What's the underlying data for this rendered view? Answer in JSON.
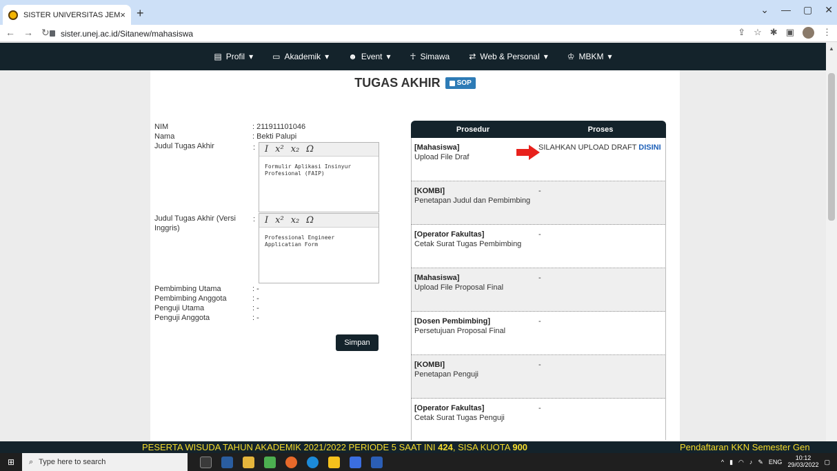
{
  "browser": {
    "tab_title": "SISTER UNIVERSITAS JEMBER",
    "tab_close": "×",
    "new_tab": "+",
    "url": "sister.unej.ac.id/Sitanew/mahasiswa"
  },
  "nav": {
    "items": [
      {
        "label": "Profil",
        "caret": "▾",
        "icon": "id-card-icon"
      },
      {
        "label": "Akademik",
        "caret": "▾",
        "icon": "monitor-icon"
      },
      {
        "label": "Event",
        "caret": "▾",
        "icon": "people-icon"
      },
      {
        "label": "Simawa",
        "caret": "",
        "icon": "run-icon"
      },
      {
        "label": "Web & Personal",
        "caret": "▾",
        "icon": "shuffle-icon"
      },
      {
        "label": "MBKM",
        "caret": "▾",
        "icon": "graduation-icon"
      }
    ]
  },
  "page": {
    "title": "TUGAS AKHIR",
    "sop_label": "SOP"
  },
  "form": {
    "nim_label": "NIM",
    "nim_value": ": 211911101046",
    "nama_label": "Nama",
    "nama_value": ": Bekti Palupi",
    "judul_label": "Judul Tugas Akhir",
    "judul_colon": ":",
    "judul_text": "Formulir Aplikasi Insinyur Profesional (FAIP)",
    "judul_en_label": "Judul Tugas Akhir (Versi Inggris)",
    "judul_en_colon": ":",
    "judul_en_text": "Professional Engineer Applicatian Form",
    "pembimbing_utama_label": "Pembimbing Utama",
    "pembimbing_utama_value": ": -",
    "pembimbing_anggota_label": "Pembimbing Anggota",
    "pembimbing_anggota_value": ": -",
    "penguji_utama_label": "Penguji Utama",
    "penguji_utama_value": ": -",
    "penguji_anggota_label": "Penguji Anggota",
    "penguji_anggota_value": ": -",
    "toolbar": {
      "italic": "I",
      "superscript": "x²",
      "subscript": "x₂",
      "omega": "Ω"
    },
    "save_label": "Simpan"
  },
  "table": {
    "header_prosedur": "Prosedur",
    "header_proses": "Proses",
    "rows": [
      {
        "role": "[Mahasiswa]",
        "desc": "Upload File Draf",
        "proses_prefix": "SILAHKAN UPLOAD DRAFT ",
        "proses_link": "DISINI"
      },
      {
        "role": "[KOMBI]",
        "desc": "Penetapan Judul dan Pembimbing",
        "proses": "-"
      },
      {
        "role": "[Operator Fakultas]",
        "desc": "Cetak Surat Tugas Pembimbing",
        "proses": "-"
      },
      {
        "role": "[Mahasiswa]",
        "desc": "Upload File Proposal Final",
        "proses": "-"
      },
      {
        "role": "[Dosen Pembimbing]",
        "desc": "Persetujuan Proposal Final",
        "proses": "-"
      },
      {
        "role": "[KOMBI]",
        "desc": "Penetapan Penguji",
        "proses": "-"
      },
      {
        "role": "[Operator Fakultas]",
        "desc": "Cetak Surat Tugas Penguji",
        "proses": "-"
      }
    ]
  },
  "ticker": {
    "part1": "PESERTA WISUDA TAHUN AKADEMIK 2021/2022 PERIODE 5 SAAT INI ",
    "count": "424",
    "part2": ", SISA KUOTA ",
    "quota": "900",
    "right_text": "Pendaftaran KKN Semester Gen"
  },
  "taskbar": {
    "search_placeholder": "Type here to search",
    "lang": "ENG",
    "time": "10:12",
    "date": "29/03/2022"
  },
  "colors": {
    "nav_bg": "#14232b",
    "sop_blue": "#2d7bb6",
    "link_blue": "#1c5fb8",
    "ticker_yellow": "#f5dd2c",
    "arrow_red": "#e8211c"
  }
}
